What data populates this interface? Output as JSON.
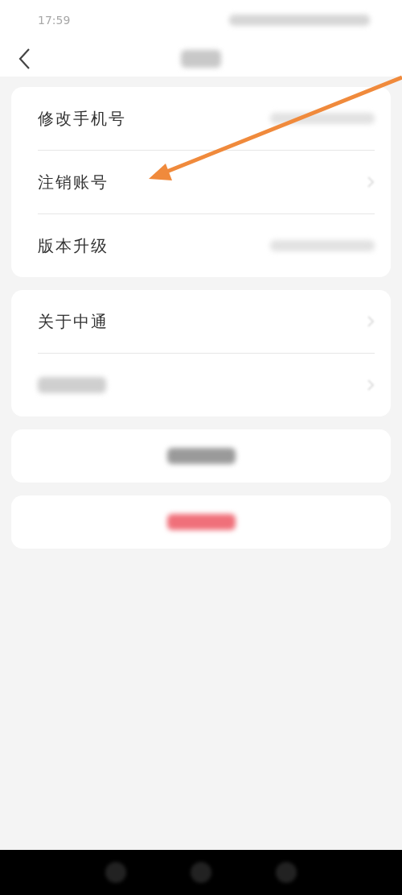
{
  "status_bar": {
    "time": "17:59"
  },
  "nav": {
    "title": {
      "kind": "redacted"
    }
  },
  "groups": [
    {
      "rows": [
        {
          "kind": "text",
          "label": "修改手机号",
          "trailing": {
            "kind": "redacted"
          }
        },
        {
          "kind": "text",
          "label": "注销账号",
          "trailing": {
            "kind": "chevron"
          }
        },
        {
          "kind": "text",
          "label": "版本升级",
          "trailing": {
            "kind": "redacted"
          }
        }
      ]
    },
    {
      "rows": [
        {
          "kind": "text",
          "label": "关于中通",
          "trailing": {
            "kind": "chevron"
          }
        },
        {
          "kind": "redacted",
          "trailing": {
            "kind": "chevron"
          }
        }
      ]
    }
  ],
  "buttons": [
    {
      "kind": "redacted",
      "color": "#9a9a9a"
    },
    {
      "kind": "redacted",
      "color": "#f0707a"
    }
  ],
  "annotation": {
    "kind": "arrow",
    "color": "#f08a3c"
  }
}
